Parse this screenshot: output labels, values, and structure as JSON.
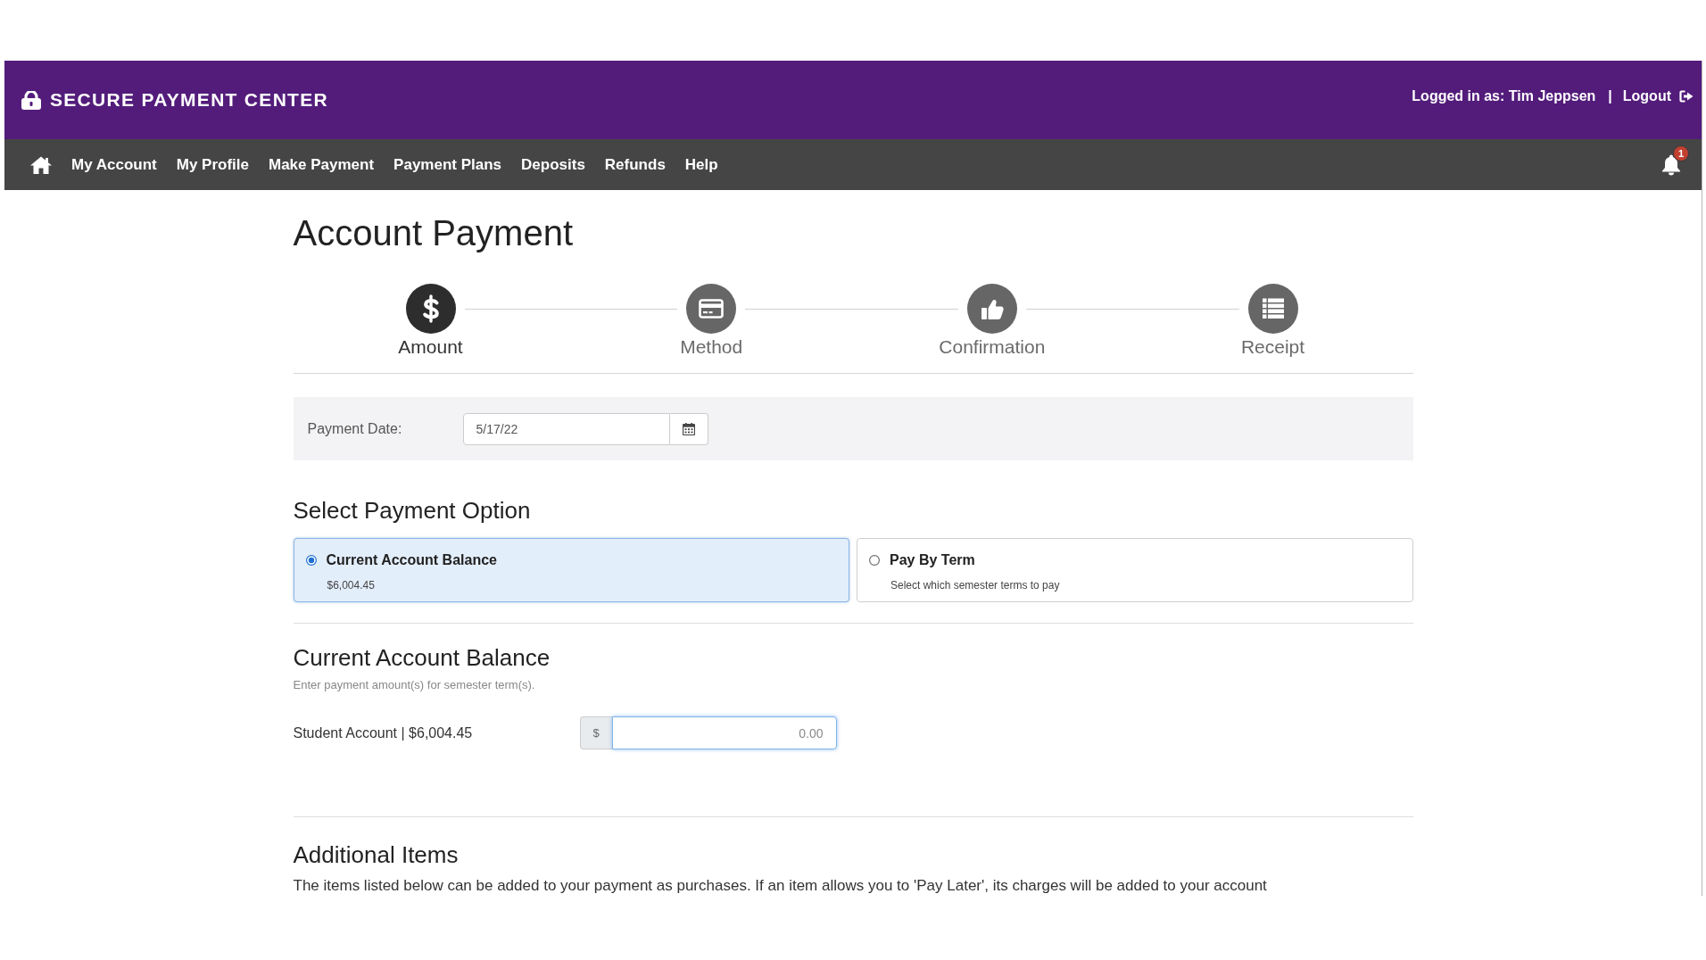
{
  "header": {
    "brand": "SECURE PAYMENT CENTER",
    "user": "Logged in as: Tim Jeppsen",
    "separator": "|",
    "logout": "Logout"
  },
  "nav": {
    "links": [
      {
        "label": "My Account"
      },
      {
        "label": "My Profile"
      },
      {
        "label": "Make Payment"
      },
      {
        "label": "Payment Plans"
      },
      {
        "label": "Deposits"
      },
      {
        "label": "Refunds"
      },
      {
        "label": "Help"
      }
    ],
    "notification_count": "1"
  },
  "page": {
    "title": "Account Payment"
  },
  "steps": [
    {
      "label": "Amount",
      "selected": true
    },
    {
      "label": "Method",
      "selected": false
    },
    {
      "label": "Confirmation",
      "selected": false
    },
    {
      "label": "Receipt",
      "selected": false
    }
  ],
  "payment_date": {
    "label": "Payment Date:",
    "value": "5/17/22"
  },
  "payment_option": {
    "title": "Select Payment Option",
    "options": [
      {
        "title": "Current Account Balance",
        "detail": "$6,004.45",
        "selected": true
      },
      {
        "title": "Pay By Term",
        "detail": "Select which semester terms to pay",
        "selected": false
      }
    ]
  },
  "balance": {
    "title": "Current Account Balance",
    "hint": "Enter payment amount(s) for semester term(s).",
    "account": {
      "label": "Student Account | $6,004.45",
      "currency": "$",
      "placeholder": "0.00",
      "focused": true
    }
  },
  "additional": {
    "title": "Additional Items",
    "text": "The items listed below can be added to your payment as purchases. If an item allows you to 'Pay Later', its charges will be added to your account"
  }
}
